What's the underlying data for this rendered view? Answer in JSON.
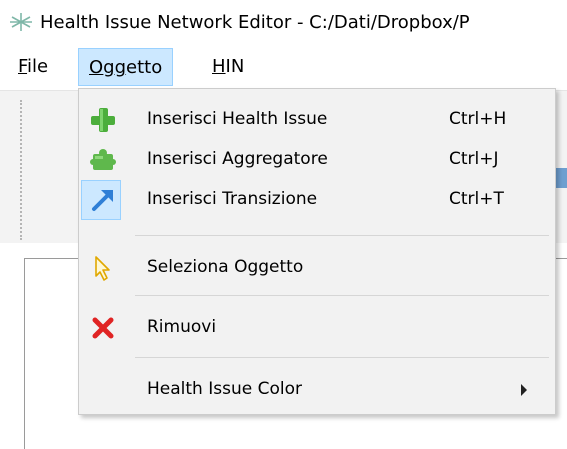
{
  "window": {
    "title": "Health Issue Network Editor - C:/Dati/Dropbox/P"
  },
  "menubar": {
    "file": {
      "first": "F",
      "rest": "ile"
    },
    "oggetto": {
      "first": "O",
      "mid": "gg",
      "rest": "etto"
    },
    "hin": {
      "first": "H",
      "rest": "IN"
    }
  },
  "dropdown": {
    "items": [
      {
        "label": "Inserisci Health Issue",
        "shortcut": "Ctrl+H",
        "icon": "green-plus-icon"
      },
      {
        "label": "Inserisci Aggregatore",
        "shortcut": "Ctrl+J",
        "icon": "green-puzzle-icon"
      },
      {
        "label": "Inserisci Transizione",
        "shortcut": "Ctrl+T",
        "icon": "blue-arrow-icon",
        "checked": true
      },
      {
        "label": "Seleziona Oggetto",
        "shortcut": "",
        "icon": "cursor-icon"
      },
      {
        "label": "Rimuovi",
        "shortcut": "",
        "icon": "red-x-icon"
      },
      {
        "label": "Health Issue Color",
        "shortcut": "",
        "icon": "submenu-arrow-icon"
      }
    ]
  },
  "colors": {
    "menu_highlight": "#cce8ff",
    "menu_highlight_border": "#99d1ff",
    "dropdown_bg": "#f2f2f2",
    "plus_green": "#4cae3c",
    "arrow_blue": "#2f7fd6",
    "remove_red": "#e02424"
  }
}
